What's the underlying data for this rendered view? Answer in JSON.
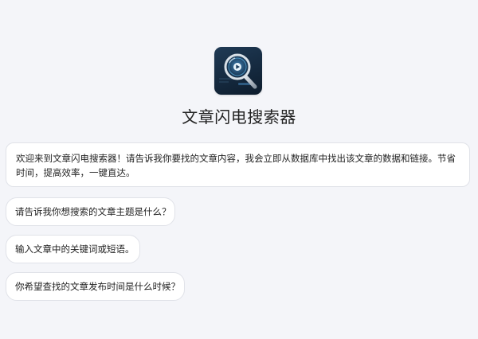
{
  "app": {
    "logo_icon": "magnifier-logo-icon",
    "title": "文章闪电搜索器"
  },
  "welcome_message": "欢迎来到文章闪电搜索器！请告诉我你要找的文章内容，我会立即从数据库中找出该文章的数据和链接。节省时间，提高效率，一键直达。",
  "suggestions": [
    "请告诉我你想搜索的文章主题是什么？",
    "输入文章中的关键词或短语。",
    "你希望查找的文章发布时间是什么时候？"
  ],
  "colors": {
    "background": "#f4f5f9",
    "card": "#ffffff",
    "border": "#e0e2e8",
    "logo_dark": "#14283d",
    "logo_accent": "#4aa8e0"
  }
}
